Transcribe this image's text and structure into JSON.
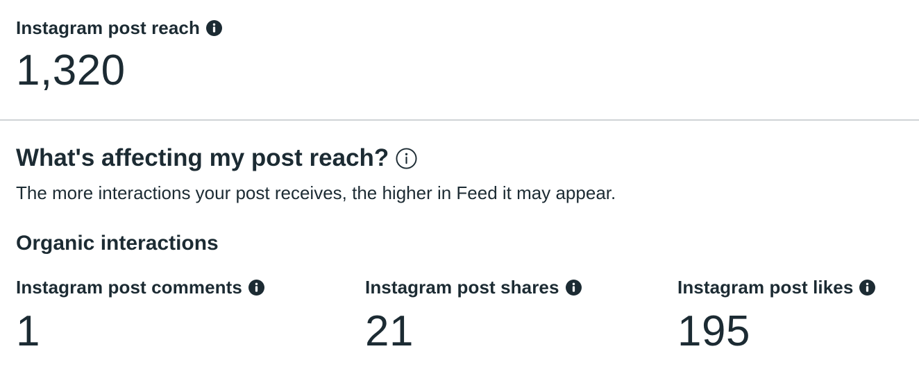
{
  "reach": {
    "label": "Instagram post reach",
    "value": "1,320"
  },
  "affecting": {
    "title": "What's affecting my post reach?",
    "subtitle": "The more interactions your post receives, the higher in Feed it may appear."
  },
  "organic": {
    "heading": "Organic interactions",
    "metrics": [
      {
        "label": "Instagram post comments",
        "value": "1"
      },
      {
        "label": "Instagram post shares",
        "value": "21"
      },
      {
        "label": "Instagram post likes",
        "value": "195"
      }
    ]
  },
  "icons": {
    "info_filled": "info-filled-icon",
    "info_outline": "info-outline-icon"
  },
  "colors": {
    "text": "#1c2b33",
    "divider": "#cfd3d6",
    "background": "#ffffff"
  }
}
